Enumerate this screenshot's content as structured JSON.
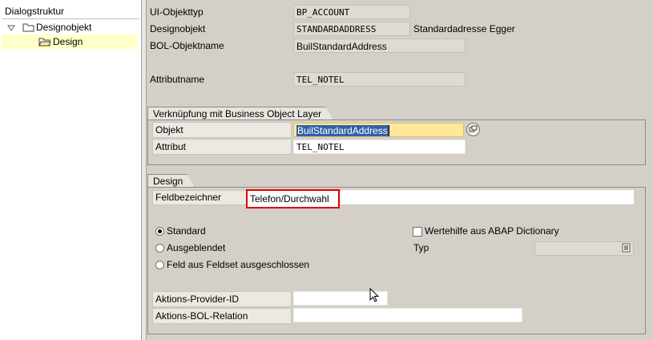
{
  "tree": {
    "header": "Dialogstruktur",
    "items": [
      {
        "label": "Designobjekt",
        "icon": "folder-icon"
      },
      {
        "label": "Design",
        "icon": "folder-open-icon"
      }
    ]
  },
  "header": {
    "ui_type_label": "UI-Objekttyp",
    "ui_type_value": "BP_ACCOUNT",
    "design_obj_label": "Designobjekt",
    "design_obj_value": "STANDARDADDRESS",
    "design_obj_desc": "Standardadresse Egger",
    "bol_name_label": "BOL-Objektname",
    "bol_name_value": "BuilStandardAddress",
    "attr_name_label": "Attributname",
    "attr_name_value": "TEL_NOTEL"
  },
  "bol_group": {
    "title": "Verknüpfung mit Business Object Layer",
    "object_label": "Objekt",
    "object_value": "BuilStandardAddress",
    "attribute_label": "Attribut",
    "attribute_value": "TEL_NOTEL"
  },
  "design_group": {
    "title": "Design",
    "field_label": "Feldbezeichner",
    "field_value": "Telefon/Durchwahl",
    "radios": [
      {
        "label": "Standard",
        "selected": true
      },
      {
        "label": "Ausgeblendet",
        "selected": false
      },
      {
        "label": "Feld aus Feldset ausgeschlossen",
        "selected": false
      }
    ],
    "checkbox_label": "Wertehilfe aus ABAP Dictionary",
    "type_label": "Typ",
    "type_value": "",
    "provider_label": "Aktions-Provider-ID",
    "provider_value": "",
    "relation_label": "Aktions-BOL-Relation",
    "relation_value": ""
  },
  "colors": {
    "highlight": "#ffe89a",
    "selection": "#3163a5",
    "red_frame": "#e00000"
  }
}
